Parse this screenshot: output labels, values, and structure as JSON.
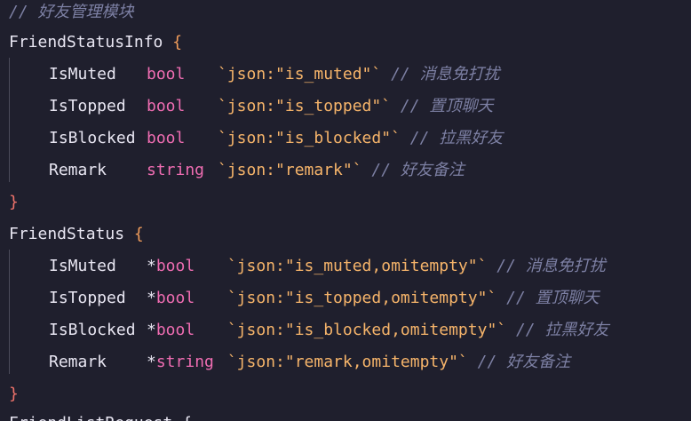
{
  "editor": {
    "comment_header": "// 好友管理模块",
    "blocks": [
      {
        "name": "FriendStatusInfo",
        "open_brace": "{",
        "close_brace": "}",
        "fields": [
          {
            "name": "IsMuted",
            "ptr": "",
            "type": "bool",
            "tag": "`json:\"is_muted\"`",
            "comment": "// 消息免打扰"
          },
          {
            "name": "IsTopped",
            "ptr": "",
            "type": "bool",
            "tag": "`json:\"is_topped\"`",
            "comment": "// 置顶聊天"
          },
          {
            "name": "IsBlocked",
            "ptr": "",
            "type": "bool",
            "tag": "`json:\"is_blocked\"`",
            "comment": "// 拉黑好友"
          },
          {
            "name": "Remark",
            "ptr": "",
            "type": "string",
            "tag": "`json:\"remark\"`",
            "comment": "// 好友备注"
          }
        ]
      },
      {
        "name": "FriendStatus",
        "open_brace": "{",
        "close_brace": "}",
        "fields": [
          {
            "name": "IsMuted",
            "ptr": "*",
            "type": "bool",
            "tag": "`json:\"is_muted,omitempty\"`",
            "comment": "// 消息免打扰"
          },
          {
            "name": "IsTopped",
            "ptr": "*",
            "type": "bool",
            "tag": "`json:\"is_topped,omitempty\"`",
            "comment": "// 置顶聊天"
          },
          {
            "name": "IsBlocked",
            "ptr": "*",
            "type": "bool",
            "tag": "`json:\"is_blocked,omitempty\"`",
            "comment": "// 拉黑好友"
          },
          {
            "name": "Remark",
            "ptr": "*",
            "type": "string",
            "tag": "`json:\"remark,omitempty\"`",
            "comment": "// 好友备注"
          }
        ]
      }
    ],
    "partial_line": "FriendListRequest {"
  },
  "colors": {
    "background": "#1f1f2d",
    "comment": "#7d80a4",
    "identifier": "#e8e6f2",
    "type_keyword": "#ef6db2",
    "struct_tag": "#f6b46a",
    "open_brace": "#f29d5b",
    "close_brace": "#f0736b",
    "indent_guide": "#4a4a5a"
  }
}
